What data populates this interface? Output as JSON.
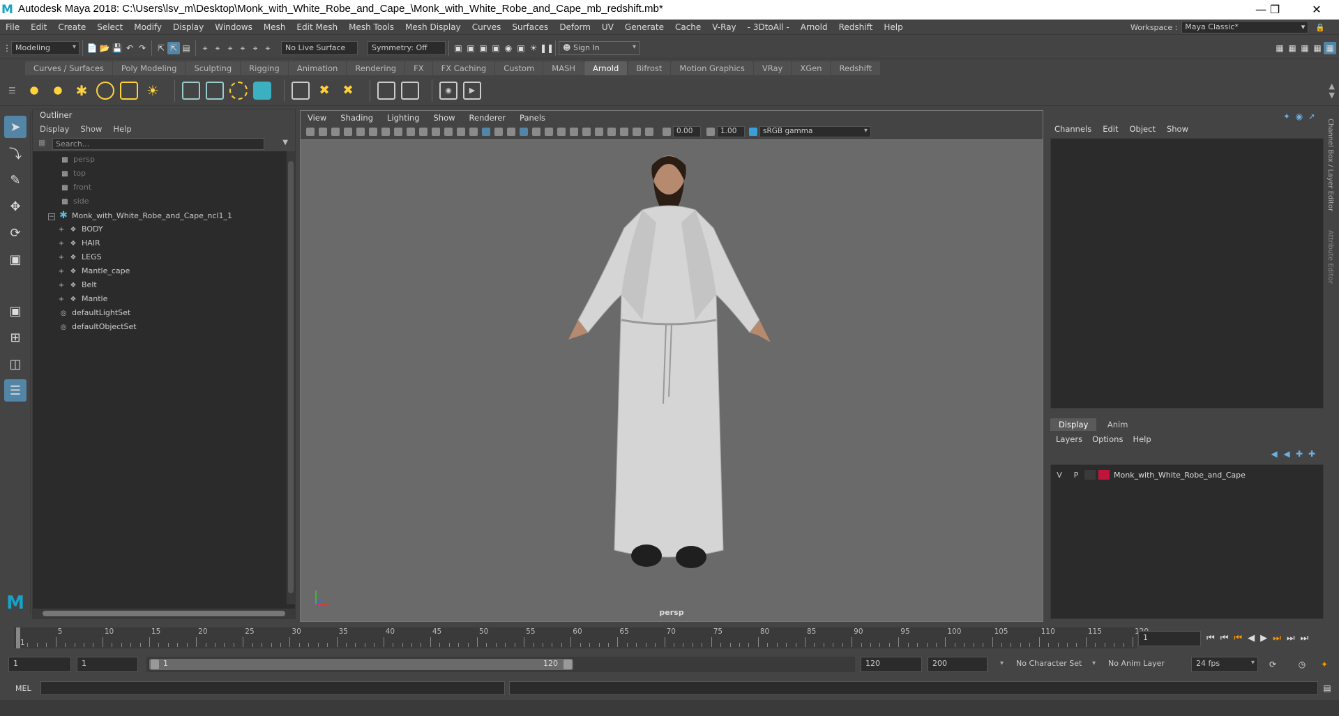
{
  "title": "Autodesk Maya 2018: C:\\Users\\lsv_m\\Desktop\\Monk_with_White_Robe_and_Cape_\\Monk_with_White_Robe_and_Cape_mb_redshift.mb*",
  "menu": [
    "File",
    "Edit",
    "Create",
    "Select",
    "Modify",
    "Display",
    "Windows",
    "Mesh",
    "Edit Mesh",
    "Mesh Tools",
    "Mesh Display",
    "Curves",
    "Surfaces",
    "Deform",
    "UV",
    "Generate",
    "Cache",
    "V-Ray",
    "- 3DtoAll -",
    "Arnold",
    "Redshift",
    "Help"
  ],
  "workspace": {
    "label": "Workspace :",
    "value": "Maya Classic*"
  },
  "status": {
    "mode": "Modeling",
    "live_surface": "No Live Surface",
    "symmetry": "Symmetry: Off",
    "sign_in": "Sign In"
  },
  "shelf_tabs": [
    "Curves / Surfaces",
    "Poly Modeling",
    "Sculpting",
    "Rigging",
    "Animation",
    "Rendering",
    "FX",
    "FX Caching",
    "Custom",
    "MASH",
    "Arnold",
    "Bifrost",
    "Motion Graphics",
    "VRay",
    "XGen",
    "Redshift"
  ],
  "shelf_active": "Arnold",
  "outliner": {
    "title": "Outliner",
    "menu": [
      "Display",
      "Show",
      "Help"
    ],
    "search_placeholder": "Search...",
    "cameras": [
      "persp",
      "top",
      "front",
      "side"
    ],
    "group": "Monk_with_White_Robe_and_Cape_ncl1_1",
    "children": [
      "BODY",
      "HAIR",
      "LEGS",
      "Mantle_cape",
      "Belt",
      "Mantle"
    ],
    "sets": [
      "defaultLightSet",
      "defaultObjectSet"
    ]
  },
  "viewport": {
    "menu": [
      "View",
      "Shading",
      "Lighting",
      "Show",
      "Renderer",
      "Panels"
    ],
    "exposure": "0.00",
    "gamma": "1.00",
    "color_space": "sRGB gamma",
    "camera_label": "persp"
  },
  "channel_box": {
    "menu": [
      "Channels",
      "Edit",
      "Object",
      "Show"
    ],
    "side_tabs": [
      "Channel Box / Layer Editor",
      "Attribute Editor"
    ]
  },
  "layer_editor": {
    "tabs": [
      "Display",
      "Anim"
    ],
    "menu": [
      "Layers",
      "Options",
      "Help"
    ],
    "layer": {
      "v": "V",
      "p": "P",
      "name": "Monk_with_White_Robe_and_Cape",
      "color": "#c0143c"
    }
  },
  "timeline": {
    "ticks": [
      "1",
      "5",
      "10",
      "15",
      "20",
      "25",
      "30",
      "35",
      "40",
      "45",
      "50",
      "55",
      "60",
      "65",
      "70",
      "75",
      "80",
      "85",
      "90",
      "95",
      "100",
      "105",
      "110",
      "115",
      "120"
    ],
    "current_frame": "1"
  },
  "range": {
    "start": "1",
    "playback_start": "1",
    "slider_start": "1",
    "slider_end": "120",
    "playback_end": "120",
    "end": "200",
    "character_set": "No Character Set",
    "anim_layer": "No Anim Layer",
    "fps": "24 fps"
  },
  "cmdline": {
    "label": "MEL"
  }
}
